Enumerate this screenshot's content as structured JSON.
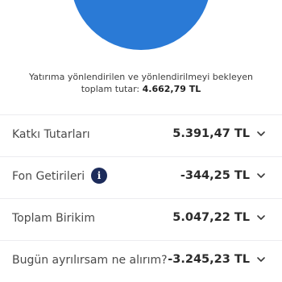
{
  "summary": {
    "text_line1": "Yatırıma yönlendirilen ve yönlendirilmeyi bekleyen",
    "text_line2_prefix": "toplam tutar:",
    "amount": "4.662,79 TL"
  },
  "rows": [
    {
      "label": "Katkı Tutarları",
      "value": "5.391,47 TL"
    },
    {
      "label": "Fon Getirileri",
      "value": "-344,25 TL",
      "info_icon": "info-icon"
    },
    {
      "label": "Toplam Birikim",
      "value": "5.047,22 TL"
    },
    {
      "label": "Bugün ayrılırsam ne alırım?",
      "value": "-3.245,23 TL"
    }
  ],
  "colors": {
    "brand_blue": "#2a7ad6",
    "info_icon": "#1c2b5a"
  }
}
